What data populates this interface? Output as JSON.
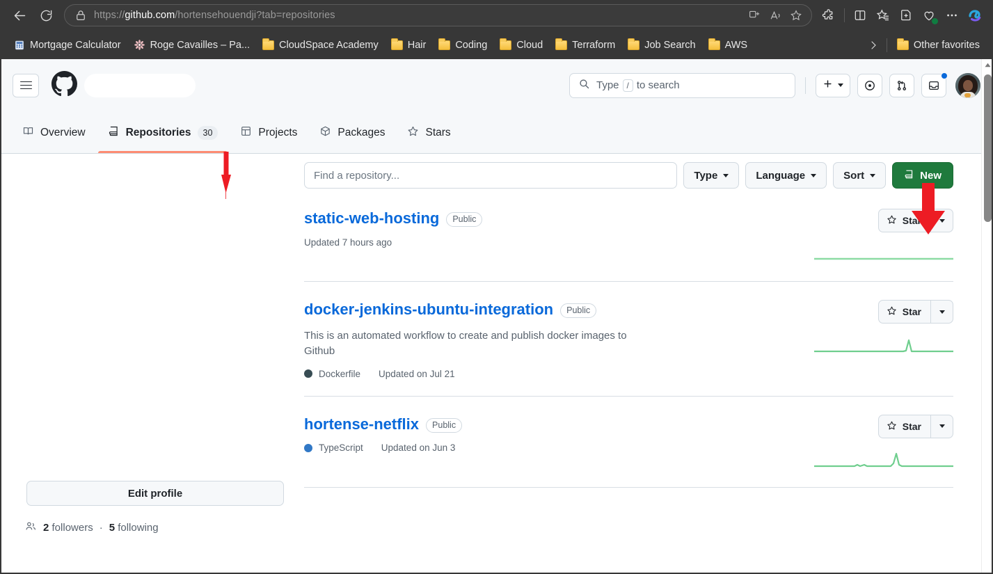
{
  "browser": {
    "back_icon": "back-arrow-icon",
    "reload_icon": "reload-icon",
    "url_prefix": "https://",
    "url_domain": "github.com",
    "url_path": "/hortensehouendji?tab=repositories",
    "omnibox_icons": [
      "split-screen-icon",
      "read-aloud-icon",
      "favorite-star-icon"
    ],
    "chrome_icons": [
      "extensions-icon",
      "split-screen-icon",
      "collections-icon",
      "add-favorite-icon",
      "browser-essentials-icon",
      "settings-more-icon",
      "copilot-icon"
    ],
    "bookmarks": [
      {
        "label": "Mortgage Calculator",
        "icon": "calculator-icon"
      },
      {
        "label": "Roge Cavailles – Pa...",
        "icon": "flower-icon"
      },
      {
        "label": "CloudSpace Academy",
        "icon": "folder-icon"
      },
      {
        "label": "Hair",
        "icon": "folder-icon"
      },
      {
        "label": "Coding",
        "icon": "folder-icon"
      },
      {
        "label": "Cloud",
        "icon": "folder-icon"
      },
      {
        "label": "Terraform",
        "icon": "folder-icon"
      },
      {
        "label": "Job Search",
        "icon": "folder-icon"
      },
      {
        "label": "AWS",
        "icon": "folder-icon"
      }
    ],
    "bookmarks_overflow_icon": "chevron-right-icon",
    "other_favorites": {
      "label": "Other favorites",
      "icon": "folder-icon"
    }
  },
  "gh_header": {
    "menu_icon": "hamburger-menu-icon",
    "logo_icon": "github-logo-icon",
    "search_placeholder": "Type",
    "search_key": "/",
    "search_suffix": "to search",
    "create_new_icon": "plus-icon",
    "issues_icon": "issues-circle-icon",
    "pull_requests_icon": "pull-request-icon",
    "inbox_icon": "inbox-icon",
    "avatar_name": "user-avatar"
  },
  "nav": {
    "tabs": [
      {
        "label": "Overview",
        "icon": "book-icon",
        "count": null,
        "active": false
      },
      {
        "label": "Repositories",
        "icon": "repo-icon",
        "count": "30",
        "active": true
      },
      {
        "label": "Projects",
        "icon": "project-table-icon",
        "count": null,
        "active": false
      },
      {
        "label": "Packages",
        "icon": "package-icon",
        "count": null,
        "active": false
      },
      {
        "label": "Stars",
        "icon": "star-icon",
        "count": null,
        "active": false
      }
    ],
    "active_underline_color": "#fd8c73"
  },
  "sidebar": {
    "edit_profile_label": "Edit profile",
    "followers_icon": "people-icon",
    "followers_count": "2",
    "followers_label": "followers",
    "separator": "·",
    "following_count": "5",
    "following_label": "following"
  },
  "filters": {
    "find_placeholder": "Find a repository...",
    "find_value": "",
    "type_label": "Type",
    "language_label": "Language",
    "sort_label": "Sort",
    "new_label": "New",
    "new_icon": "repo-icon",
    "new_color": "#1f7a3d"
  },
  "repos": [
    {
      "name": "static-web-hosting",
      "visibility": "Public",
      "description": "",
      "language": "",
      "language_color": "",
      "updated": "Updated 7 hours ago",
      "star_label": "Star",
      "star_icon": "star-icon",
      "sparkline": [
        0,
        0,
        0,
        0,
        0,
        0,
        0,
        0,
        0,
        0,
        0,
        0,
        0,
        0,
        0,
        0,
        0,
        0,
        0,
        0
      ]
    },
    {
      "name": "docker-jenkins-ubuntu-integration",
      "visibility": "Public",
      "description": "This is an automated workflow to create and publish docker images to Github",
      "language": "Dockerfile",
      "language_color": "#384d54",
      "updated": "Updated on Jul 21",
      "star_label": "Star",
      "star_icon": "star-icon",
      "sparkline": [
        0,
        0,
        0,
        0,
        0,
        0,
        0,
        0,
        0,
        0,
        0,
        0,
        0,
        1,
        8,
        1,
        0,
        0,
        0,
        0
      ]
    },
    {
      "name": "hortense-netflix",
      "visibility": "Public",
      "description": "",
      "language": "TypeScript",
      "language_color": "#3178c6",
      "updated": "Updated on Jun 3",
      "star_label": "Star",
      "star_icon": "star-icon",
      "sparkline": [
        0,
        0,
        0,
        0,
        0,
        1,
        1,
        0,
        1,
        1,
        0,
        0,
        0,
        1,
        10,
        1,
        0,
        0,
        0,
        0
      ]
    }
  ],
  "annotations": [
    {
      "name": "arrow-pointing-to-repositories-tab",
      "color": "#ed1c24",
      "target": "Repositories tab count badge"
    },
    {
      "name": "arrow-pointing-to-new-button",
      "color": "#ed1c24",
      "target": "New repository button"
    }
  ],
  "scrollbar": {
    "up_arrow_icon": "scroll-up-arrow-icon"
  }
}
